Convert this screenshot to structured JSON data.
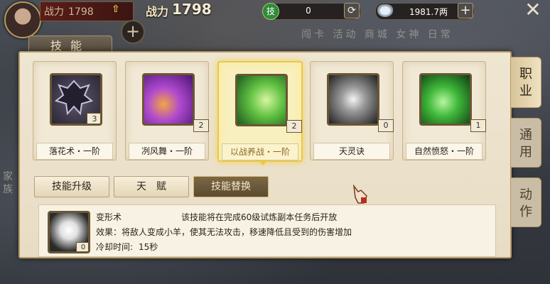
{
  "top": {
    "hp_label": "战力",
    "hp_value": "1798",
    "power_label": "战力",
    "power_value": "1798",
    "resource1_icon_label": "技",
    "resource1_value": "0",
    "resource2_value": "1981.7两",
    "bg_menu": "闯卡 活动 商城 女神 日常"
  },
  "panel": {
    "tab_title": "技能",
    "skills": [
      {
        "name": "落花术・一阶",
        "count": "3"
      },
      {
        "name": "冽风舞・一阶",
        "count": "2"
      },
      {
        "name": "以战养战・一阶",
        "count": "2"
      },
      {
        "name": "天灵诀",
        "count": "0"
      },
      {
        "name": "自然愤怒・一阶",
        "count": "1"
      }
    ],
    "selected_index": 2,
    "buttons": [
      "技能升级",
      "天　赋",
      "技能替换"
    ],
    "active_button": 2
  },
  "side_tabs": [
    "职业",
    "通用",
    "动作"
  ],
  "side_active": 0,
  "detail": {
    "skill_name": "变形术",
    "count": "0",
    "unlock_note": "该技能将在完成60级试炼副本任务后开放",
    "effect": "效果：将敌人变成小羊，使其无法攻击，移速降低且受到的伤害增加",
    "cooldown_label": "冷却时间:",
    "cooldown_value": "15秒"
  },
  "left_fragment": "家族",
  "colors": {
    "accent": "#e9c94a",
    "warning": "#c0281c",
    "panel_bg": "#efe6d2"
  }
}
